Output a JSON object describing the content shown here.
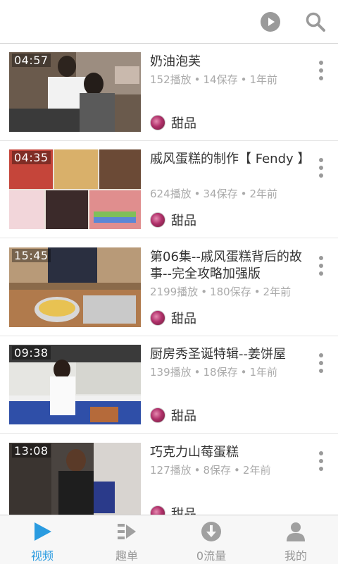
{
  "colors": {
    "accent": "#2a9be0",
    "muted": "#999999",
    "meta": "#aaaaaa"
  },
  "toolbar": {
    "play_icon": "play-circle-icon",
    "search_icon": "search-icon"
  },
  "videos": [
    {
      "duration": "04:57",
      "title": "奶油泡芙",
      "plays": "152播放",
      "saves": "14保存",
      "age": "1年前",
      "category": "甜品"
    },
    {
      "duration": "04:35",
      "title": "戚风蛋糕的制作【 Fendy 】",
      "plays": "624播放",
      "saves": "34保存",
      "age": "2年前",
      "category": "甜品"
    },
    {
      "duration": "15:45",
      "title": "第06集--戚风蛋糕背后的故事--完全攻略加强版",
      "plays": "2199播放",
      "saves": "180保存",
      "age": "2年前",
      "category": "甜品"
    },
    {
      "duration": "09:38",
      "title": "厨房秀圣诞特辑--姜饼屋",
      "plays": "139播放",
      "saves": "18保存",
      "age": "1年前",
      "category": "甜品"
    },
    {
      "duration": "13:08",
      "title": "巧克力山莓蛋糕",
      "plays": "127播放",
      "saves": "8保存",
      "age": "2年前",
      "category": "甜品"
    }
  ],
  "tabs": [
    {
      "label": "视频",
      "icon": "play-triangle-icon",
      "active": true
    },
    {
      "label": "趣单",
      "icon": "list-play-icon",
      "active": false
    },
    {
      "label": "0流量",
      "icon": "download-icon",
      "active": false
    },
    {
      "label": "我的",
      "icon": "person-icon",
      "active": false
    }
  ]
}
